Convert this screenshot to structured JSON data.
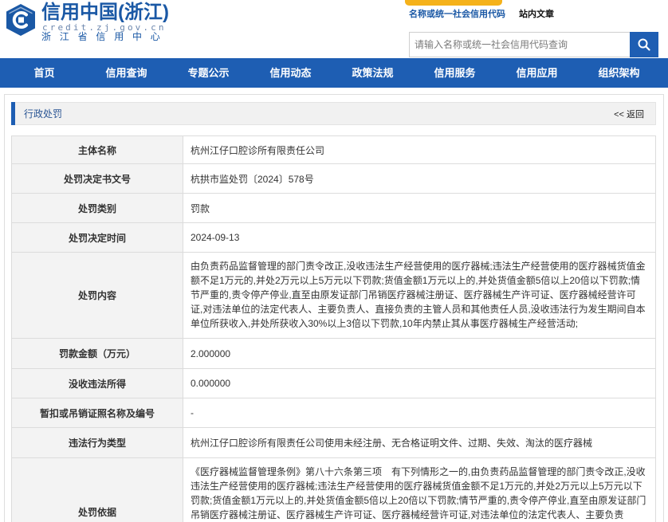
{
  "header": {
    "site_name": "信用中国(浙江)",
    "domain": "credit.zj.gov.cn",
    "org_name": "浙江省信用中心",
    "search_tabs": [
      {
        "label": "名称或统一社会信用代码",
        "active": true
      },
      {
        "label": "站内文章",
        "active": false
      }
    ],
    "search_placeholder": "请输入名称或统一社会信用代码查询",
    "search_value": "",
    "search_button_icon": "search-icon"
  },
  "nav": {
    "items": [
      {
        "label": "首页"
      },
      {
        "label": "信用查询"
      },
      {
        "label": "专题公示"
      },
      {
        "label": "信用动态"
      },
      {
        "label": "政策法规"
      },
      {
        "label": "信用服务"
      },
      {
        "label": "信用应用"
      },
      {
        "label": "组织架构"
      }
    ]
  },
  "section": {
    "title": "行政处罚",
    "back_label": "<< 返回"
  },
  "details": [
    {
      "label": "主体名称",
      "value": "杭州江仔口腔诊所有限责任公司"
    },
    {
      "label": "处罚决定书文号",
      "value": "杭拱市监处罚〔2024〕578号"
    },
    {
      "label": "处罚类别",
      "value": "罚款"
    },
    {
      "label": "处罚决定时间",
      "value": "2024-09-13"
    },
    {
      "label": "处罚内容",
      "value": "由负责药品监督管理的部门责令改正,没收违法生产经营使用的医疗器械;违法生产经营使用的医疗器械货值金额不足1万元的,并处2万元以上5万元以下罚款;货值金额1万元以上的,并处货值金额5倍以上20倍以下罚款;情节严重的,责令停产停业,直至由原发证部门吊销医疗器械注册证、医疗器械生产许可证、医疗器械经营许可证,对违法单位的法定代表人、主要负责人、直接负责的主管人员和其他责任人员,没收违法行为发生期间自本单位所获收入,并处所获收入30%以上3倍以下罚款,10年内禁止其从事医疗器械生产经营活动;"
    },
    {
      "label": "罚款金额（万元）",
      "value": "2.000000"
    },
    {
      "label": "没收违法所得",
      "value": "0.000000"
    },
    {
      "label": "暂扣或吊销证照名称及编号",
      "value": "-"
    },
    {
      "label": "违法行为类型",
      "value": "杭州江仔口腔诊所有限责任公司使用未经注册、无合格证明文件、过期、失效、淘汰的医疗器械"
    },
    {
      "label": "处罚依据",
      "value": "《医疗器械监督管理条例》第八十六条第三项　有下列情形之一的,由负责药品监督管理的部门责令改正,没收违法生产经营使用的医疗器械;违法生产经营使用的医疗器械货值金额不足1万元的,并处2万元以上5万元以下罚款;货值金额1万元以上的,并处货值金额5倍以上20倍以下罚款;情节严重的,责令停产停业,直至由原发证部门吊销医疗器械注册证、医疗器械生产许可证、医疗器械经营许可证,对违法单位的法定代表人、主要负责"
    }
  ],
  "colors": {
    "primary": "#1e5eb3",
    "primary_dark": "#1a58a5",
    "accent": "#f5b21b",
    "label_bg": "#f3f3f3"
  }
}
